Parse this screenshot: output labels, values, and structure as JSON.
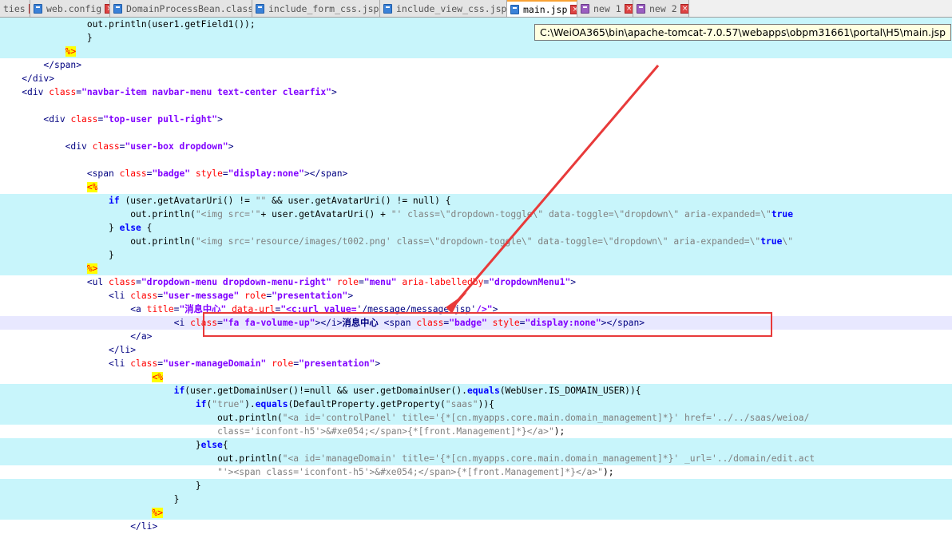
{
  "tabs": [
    {
      "label": "ties",
      "icon": "none",
      "active": false
    },
    {
      "label": "web.config",
      "icon": "blue",
      "active": false
    },
    {
      "label": "DomainProcessBean.class",
      "icon": "blue",
      "active": false
    },
    {
      "label": "include_form_css.jsp",
      "icon": "blue",
      "active": false
    },
    {
      "label": "include_view_css.jsp",
      "icon": "blue",
      "active": false
    },
    {
      "label": "main.jsp",
      "icon": "blue",
      "active": true
    },
    {
      "label": "new 1",
      "icon": "purple",
      "active": false
    },
    {
      "label": "new 2",
      "icon": "purple",
      "active": false
    }
  ],
  "tooltip": "C:\\WeiOA365\\bin\\apache-tomcat-7.0.57\\webapps\\obpm31661\\portal\\H5\\main.jsp",
  "lines": [
    {
      "hl": true,
      "t": [
        [
          "p",
          "                out.println(user1.getField1());"
        ]
      ]
    },
    {
      "hl": true,
      "t": [
        [
          "p",
          "                }"
        ]
      ]
    },
    {
      "hl": true,
      "t": [
        [
          "p",
          "            "
        ],
        [
          "dl",
          "%>"
        ]
      ]
    },
    {
      "hl": false,
      "t": [
        [
          "p",
          "        "
        ],
        [
          "tg",
          "</span>"
        ]
      ]
    },
    {
      "hl": false,
      "t": [
        [
          "p",
          "    "
        ],
        [
          "tg",
          "</div>"
        ]
      ]
    },
    {
      "hl": false,
      "t": [
        [
          "p",
          "    "
        ],
        [
          "tg",
          "<div "
        ],
        [
          "at",
          "class"
        ],
        [
          "tg",
          "="
        ],
        [
          "st",
          "\"navbar-item navbar-menu text-center clearfix\""
        ],
        [
          "tg",
          ">"
        ]
      ]
    },
    {
      "hl": false,
      "t": []
    },
    {
      "hl": false,
      "t": [
        [
          "p",
          "        "
        ],
        [
          "tg",
          "<div "
        ],
        [
          "at",
          "class"
        ],
        [
          "tg",
          "="
        ],
        [
          "st",
          "\"top-user pull-right\""
        ],
        [
          "tg",
          ">"
        ]
      ]
    },
    {
      "hl": false,
      "t": []
    },
    {
      "hl": false,
      "t": [
        [
          "p",
          "            "
        ],
        [
          "tg",
          "<div "
        ],
        [
          "at",
          "class"
        ],
        [
          "tg",
          "="
        ],
        [
          "st",
          "\"user-box dropdown\""
        ],
        [
          "tg",
          ">"
        ]
      ]
    },
    {
      "hl": false,
      "t": []
    },
    {
      "hl": false,
      "t": [
        [
          "p",
          "                "
        ],
        [
          "tg",
          "<span "
        ],
        [
          "at",
          "class"
        ],
        [
          "tg",
          "="
        ],
        [
          "st",
          "\"badge\""
        ],
        [
          "p",
          " "
        ],
        [
          "at",
          "style"
        ],
        [
          "tg",
          "="
        ],
        [
          "st",
          "\"display:none\""
        ],
        [
          "tg",
          "></span>"
        ]
      ]
    },
    {
      "hl": false,
      "t": [
        [
          "p",
          "                "
        ],
        [
          "dl",
          "<%"
        ]
      ]
    },
    {
      "hl": true,
      "t": [
        [
          "p",
          "                    "
        ],
        [
          "jk",
          "if"
        ],
        [
          "p",
          " (user.getAvatarUri() != "
        ],
        [
          "js",
          "\"\""
        ],
        [
          "p",
          " && user.getAvatarUri() != null) {"
        ]
      ]
    },
    {
      "hl": true,
      "t": [
        [
          "p",
          "                        out.println("
        ],
        [
          "js",
          "\"<img src='\""
        ],
        [
          "p",
          "+ user.getAvatarUri() + "
        ],
        [
          "js",
          "\"' class=\\\"dropdown-toggle\\\" data-toggle=\\\"dropdown\\\" aria-expanded=\\\""
        ],
        [
          "jk",
          "true"
        ]
      ]
    },
    {
      "hl": true,
      "t": [
        [
          "p",
          "                    } "
        ],
        [
          "jk",
          "else"
        ],
        [
          "p",
          " {"
        ]
      ]
    },
    {
      "hl": true,
      "t": [
        [
          "p",
          "                        out.println("
        ],
        [
          "js",
          "\"<img src='resource/images/t002.png' class=\\\"dropdown-toggle\\\" data-toggle=\\\"dropdown\\\" aria-expanded=\\\""
        ],
        [
          "jk",
          "true"
        ],
        [
          "js",
          "\\\""
        ]
      ]
    },
    {
      "hl": true,
      "t": [
        [
          "p",
          "                    }"
        ]
      ]
    },
    {
      "hl": true,
      "t": [
        [
          "p",
          "                "
        ],
        [
          "dl",
          "%>"
        ]
      ]
    },
    {
      "hl": false,
      "t": [
        [
          "p",
          "                "
        ],
        [
          "tg",
          "<ul "
        ],
        [
          "at",
          "class"
        ],
        [
          "tg",
          "="
        ],
        [
          "st",
          "\"dropdown-menu dropdown-menu-right\""
        ],
        [
          "p",
          " "
        ],
        [
          "at",
          "role"
        ],
        [
          "tg",
          "="
        ],
        [
          "st",
          "\"menu\""
        ],
        [
          "p",
          " "
        ],
        [
          "at",
          "aria-labelledby"
        ],
        [
          "tg",
          "="
        ],
        [
          "st",
          "\"dropdownMenu1\""
        ],
        [
          "tg",
          ">"
        ]
      ]
    },
    {
      "hl": false,
      "t": [
        [
          "p",
          "                    "
        ],
        [
          "tg",
          "<li "
        ],
        [
          "at",
          "class"
        ],
        [
          "tg",
          "="
        ],
        [
          "st",
          "\"user-message\""
        ],
        [
          "p",
          " "
        ],
        [
          "at",
          "role"
        ],
        [
          "tg",
          "="
        ],
        [
          "st",
          "\"presentation\""
        ],
        [
          "tg",
          ">"
        ]
      ]
    },
    {
      "hl": false,
      "t": [
        [
          "p",
          "                        "
        ],
        [
          "tg",
          "<a "
        ],
        [
          "at",
          "title"
        ],
        [
          "tg",
          "="
        ],
        [
          "st",
          "\"消息中心\""
        ],
        [
          "p",
          " "
        ],
        [
          "at",
          "data-url"
        ],
        [
          "tg",
          "="
        ],
        [
          "st",
          "\"<c:url value="
        ],
        [
          "tg",
          "'/message/message.jsp'"
        ],
        [
          "st",
          "/>\""
        ],
        [
          "tg",
          ">"
        ]
      ]
    },
    {
      "hl": false,
      "cur": true,
      "t": [
        [
          "p",
          "                                "
        ],
        [
          "tg",
          "<i "
        ],
        [
          "at",
          "class"
        ],
        [
          "tg",
          "="
        ],
        [
          "st",
          "\"fa fa-volume-up\""
        ],
        [
          "tg",
          "></i>"
        ],
        [
          "op",
          "消息中心"
        ],
        [
          "p",
          " "
        ],
        [
          "tg",
          "<span "
        ],
        [
          "at",
          "class"
        ],
        [
          "tg",
          "="
        ],
        [
          "st",
          "\"badge\""
        ],
        [
          "p",
          " "
        ],
        [
          "at",
          "style"
        ],
        [
          "tg",
          "="
        ],
        [
          "st",
          "\"display:none\""
        ],
        [
          "tg",
          "></span>"
        ]
      ]
    },
    {
      "hl": false,
      "t": [
        [
          "p",
          "                        "
        ],
        [
          "tg",
          "</a>"
        ]
      ]
    },
    {
      "hl": false,
      "t": [
        [
          "p",
          "                    "
        ],
        [
          "tg",
          "</li>"
        ]
      ]
    },
    {
      "hl": false,
      "t": [
        [
          "p",
          "                    "
        ],
        [
          "tg",
          "<li "
        ],
        [
          "at",
          "class"
        ],
        [
          "tg",
          "="
        ],
        [
          "st",
          "\"user-manageDomain\""
        ],
        [
          "p",
          " "
        ],
        [
          "at",
          "role"
        ],
        [
          "tg",
          "="
        ],
        [
          "st",
          "\"presentation\""
        ],
        [
          "tg",
          ">"
        ]
      ]
    },
    {
      "hl": false,
      "t": [
        [
          "p",
          "                            "
        ],
        [
          "dl",
          "<%"
        ]
      ]
    },
    {
      "hl": true,
      "t": [
        [
          "p",
          "                                "
        ],
        [
          "jk",
          "if"
        ],
        [
          "p",
          "(user.getDomainUser()!=null && user.getDomainUser()."
        ],
        [
          "jk",
          "equals"
        ],
        [
          "p",
          "(WebUser.IS_DOMAIN_USER)){"
        ]
      ]
    },
    {
      "hl": true,
      "t": [
        [
          "p",
          "                                    "
        ],
        [
          "jk",
          "if"
        ],
        [
          "p",
          "("
        ],
        [
          "js",
          "\"true\""
        ],
        [
          "p",
          ")."
        ],
        [
          "jk",
          "equals"
        ],
        [
          "p",
          "(DefaultProperty.getProperty("
        ],
        [
          "js",
          "\"saas\""
        ],
        [
          "p",
          ")){"
        ]
      ]
    },
    {
      "hl": true,
      "t": [
        [
          "p",
          "                                        out.println("
        ],
        [
          "js",
          "\"<a id='controlPanel' title='{*[cn.myapps.core.main.domain_management]*}' href='../../saas/weioa/"
        ]
      ]
    },
    {
      "hl": false,
      "t": [
        [
          "p",
          "                                        "
        ],
        [
          "js",
          "class='iconfont-h5'>&#xe054;</span>{*[front.Management]*}</a>\""
        ],
        [
          "p",
          ");"
        ]
      ]
    },
    {
      "hl": true,
      "t": [
        [
          "p",
          "                                    }"
        ],
        [
          "jk",
          "else"
        ],
        [
          "p",
          "{"
        ]
      ]
    },
    {
      "hl": true,
      "t": [
        [
          "p",
          "                                        out.println("
        ],
        [
          "js",
          "\"<a id='manageDomain' title='{*[cn.myapps.core.main.domain_management]*}' _url='../domain/edit.act"
        ]
      ]
    },
    {
      "hl": false,
      "t": [
        [
          "p",
          "                                        "
        ],
        [
          "js",
          "\"'><span class='iconfont-h5'>&#xe054;</span>{*[front.Management]*}</a>\""
        ],
        [
          "p",
          ");"
        ]
      ]
    },
    {
      "hl": true,
      "t": [
        [
          "p",
          "                                    }"
        ]
      ]
    },
    {
      "hl": true,
      "t": [
        [
          "p",
          "                                }"
        ]
      ]
    },
    {
      "hl": true,
      "t": [
        [
          "p",
          "                            "
        ],
        [
          "dl",
          "%>"
        ]
      ]
    },
    {
      "hl": false,
      "t": [
        [
          "p",
          "                        "
        ],
        [
          "tg",
          "</li>"
        ]
      ]
    }
  ]
}
